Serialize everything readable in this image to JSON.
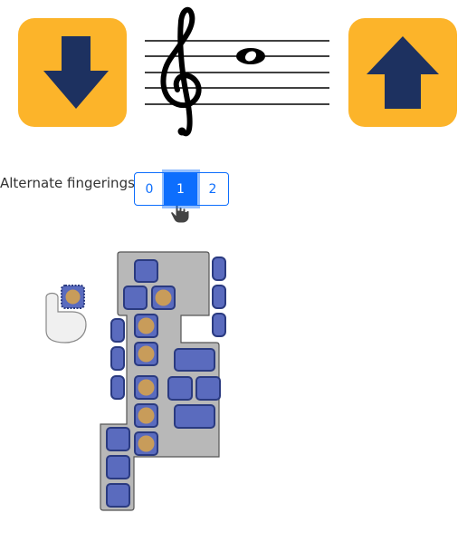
{
  "toolbar": {
    "down_button": {
      "icon": "arrow-down-icon",
      "color": "#fcb42a",
      "arrow_color": "#1d3160"
    },
    "up_button": {
      "icon": "arrow-up-icon",
      "color": "#fcb42a",
      "arrow_color": "#1d3160"
    }
  },
  "notation": {
    "clef": "treble-clef-icon",
    "note": "whole-note-icon"
  },
  "fingerings": {
    "label": "Alternate fingerings:",
    "options": [
      "0",
      "1",
      "2"
    ],
    "selected": "1"
  },
  "diagram": {
    "thumb_hand_icon": "thumb-icon",
    "key_color": "#5a6bbe",
    "pressed_color": "#c89c5a",
    "body_color": "#b8b8b8"
  }
}
